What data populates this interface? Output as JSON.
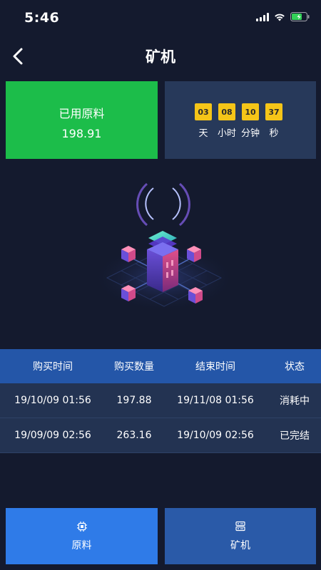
{
  "status_bar": {
    "time": "5:46"
  },
  "nav": {
    "title": "矿机"
  },
  "used_card": {
    "label": "已用原料",
    "value": "198.91"
  },
  "countdown": [
    {
      "value": "03",
      "unit": "天"
    },
    {
      "value": "08",
      "unit": "小时"
    },
    {
      "value": "10",
      "unit": "分钟"
    },
    {
      "value": "37",
      "unit": "秒"
    }
  ],
  "table": {
    "headers": [
      "购买时间",
      "购买数量",
      "结束时间",
      "状态"
    ],
    "rows": [
      [
        "19/10/09 01:56",
        "197.88",
        "19/11/08 01:56",
        "消耗中"
      ],
      [
        "19/09/09 02:56",
        "263.16",
        "19/10/09 02:56",
        "已完结"
      ]
    ]
  },
  "tabs": [
    {
      "label": "原料",
      "icon": "chip-icon"
    },
    {
      "label": "矿机",
      "icon": "server-icon"
    }
  ],
  "colors": {
    "background": "#141a2e",
    "green": "#1cbd4a",
    "timer_yellow": "#f5c518",
    "header_blue": "#2456a8",
    "tab_active": "#2f7be8"
  }
}
